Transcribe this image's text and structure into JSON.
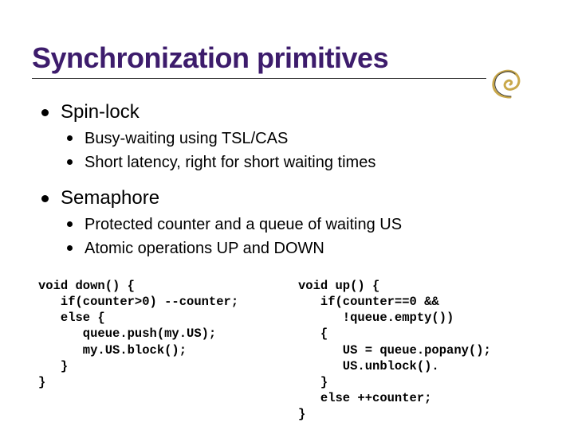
{
  "title": "Synchronization primitives",
  "sections": [
    {
      "heading": "Spin-lock",
      "items": [
        "Busy-waiting using TSL/CAS",
        "Short latency, right for short waiting times"
      ]
    },
    {
      "heading": "Semaphore",
      "items": [
        "Protected counter and a queue of waiting US",
        "Atomic operations UP and DOWN"
      ]
    }
  ],
  "code": {
    "down": "void down() {\n   if(counter>0) --counter;\n   else {\n      queue.push(my.US);\n      my.US.block();\n   }\n}",
    "up": "void up() {\n   if(counter==0 &&\n      !queue.empty())\n   {\n      US = queue.popany();\n      US.unblock().\n   }\n   else ++counter;\n}"
  }
}
